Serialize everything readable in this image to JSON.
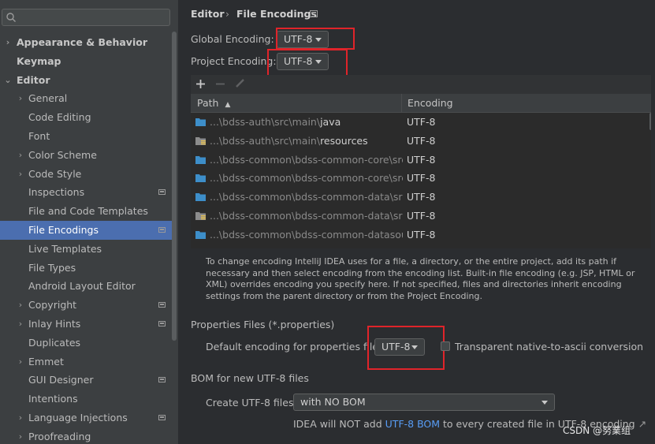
{
  "sidebar": {
    "search": {
      "value": "",
      "placeholder": ""
    },
    "items": [
      {
        "label": "Appearance & Behavior",
        "arrow": "›",
        "bold": true
      },
      {
        "label": "Keymap",
        "arrow": "",
        "bold": true
      },
      {
        "label": "Editor",
        "arrow": "⌄",
        "bold": true
      },
      {
        "label": "General",
        "arrow": "›"
      },
      {
        "label": "Code Editing",
        "arrow": ""
      },
      {
        "label": "Font",
        "arrow": ""
      },
      {
        "label": "Color Scheme",
        "arrow": "›"
      },
      {
        "label": "Code Style",
        "arrow": "›"
      },
      {
        "label": "Inspections",
        "arrow": "",
        "marker": true
      },
      {
        "label": "File and Code Templates",
        "arrow": ""
      },
      {
        "label": "File Encodings",
        "arrow": "",
        "marker": true,
        "selected": true
      },
      {
        "label": "Live Templates",
        "arrow": ""
      },
      {
        "label": "File Types",
        "arrow": ""
      },
      {
        "label": "Android Layout Editor",
        "arrow": ""
      },
      {
        "label": "Copyright",
        "arrow": "›",
        "marker": true
      },
      {
        "label": "Inlay Hints",
        "arrow": "›",
        "marker": true
      },
      {
        "label": "Duplicates",
        "arrow": ""
      },
      {
        "label": "Emmet",
        "arrow": "›"
      },
      {
        "label": "GUI Designer",
        "arrow": "",
        "marker": true
      },
      {
        "label": "Intentions",
        "arrow": ""
      },
      {
        "label": "Language Injections",
        "arrow": "›",
        "marker": true
      },
      {
        "label": "Proofreading",
        "arrow": "›"
      }
    ]
  },
  "breadcrumb": {
    "parent": "Editor",
    "separator": "›",
    "current": "File Encodings"
  },
  "global_encoding": {
    "label": "Global Encoding:",
    "value": "UTF-8"
  },
  "project_encoding": {
    "label": "Project Encoding:",
    "value": "UTF-8"
  },
  "table": {
    "columns": {
      "path": "Path",
      "sort_arrow": "▲",
      "encoding": "Encoding"
    },
    "rows": [
      {
        "dim": "...\\bdss-auth\\src\\main\\",
        "hi": "java",
        "encoding": "UTF-8",
        "icon": "folder"
      },
      {
        "dim": "...\\bdss-auth\\src\\main\\",
        "hi": "resources",
        "encoding": "UTF-8",
        "icon": "resources-folder"
      },
      {
        "dim": "...\\bdss-common\\bdss-common-core\\src\\ma",
        "hi": "",
        "encoding": "UTF-8",
        "icon": "folder"
      },
      {
        "dim": "...\\bdss-common\\bdss-common-core\\src\\ma",
        "hi": "",
        "encoding": "UTF-8",
        "icon": "folder"
      },
      {
        "dim": "...\\bdss-common\\bdss-common-data\\src\\ma",
        "hi": "",
        "encoding": "UTF-8",
        "icon": "folder"
      },
      {
        "dim": "...\\bdss-common\\bdss-common-data\\src\\ma",
        "hi": "",
        "encoding": "UTF-8",
        "icon": "resources-folder"
      },
      {
        "dim": "...\\bdss-common\\bdss-common-datasource\\",
        "hi": "",
        "encoding": "UTF-8",
        "icon": "folder"
      }
    ]
  },
  "description": "To change encoding IntelliJ IDEA uses for a file, a directory, or the entire project, add its path if necessary and then select encoding from the encoding list. Built-in file encoding (e.g. JSP, HTML or XML) overrides encoding you specify here. If not specified, files and directories inherit encoding settings from the parent directory or from the Project Encoding.",
  "properties": {
    "section_title": "Properties Files (*.properties)",
    "default_label": "Default encoding for properties files:",
    "default_value": "UTF-8",
    "transparent_label": "Transparent native-to-ascii conversion"
  },
  "bom": {
    "section_title": "BOM for new UTF-8 files",
    "create_label": "Create UTF-8 files:",
    "create_value": "with NO BOM",
    "note_prefix": "IDEA will NOT add ",
    "note_link": "UTF-8 BOM",
    "note_suffix": " to every created file in UTF-8 encoding",
    "note_arrow": "↗"
  },
  "watermark": "CSDN @努業组",
  "colors": {
    "selection": "#4b6eaf",
    "link": "#589df6",
    "highlight_box": "#e0242a",
    "folder_blue": "#3d8ec9"
  }
}
